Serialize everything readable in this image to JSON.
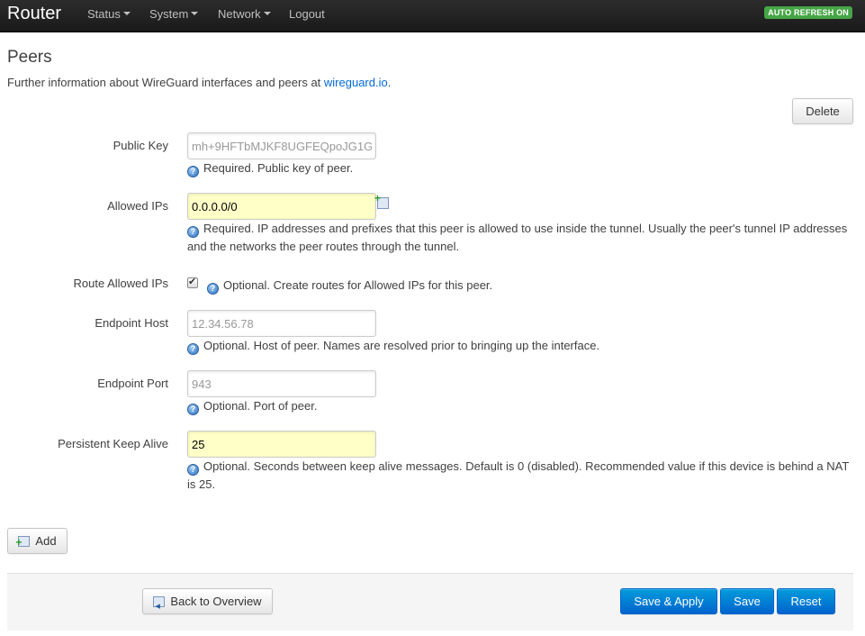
{
  "navbar": {
    "brand": "Router",
    "menu": [
      "Status",
      "System",
      "Network",
      "Logout"
    ],
    "refresh_badge": "AUTO REFRESH ON"
  },
  "header": {
    "title": "Peers",
    "desc_prefix": "Further information about WireGuard interfaces and peers at ",
    "desc_link": "wireguard.io",
    "desc_suffix": "."
  },
  "buttons": {
    "delete": "Delete",
    "add": "Add",
    "back": "Back to Overview",
    "save_apply": "Save & Apply",
    "save": "Save",
    "reset": "Reset"
  },
  "fields": {
    "public_key": {
      "label": "Public Key",
      "value": "",
      "placeholder": "mh+9HFTbMJKF8UGFEQpoJG1G",
      "help": "Required. Public key of peer."
    },
    "allowed_ips": {
      "label": "Allowed IPs",
      "value": "0.0.0.0/0",
      "help": "Required. IP addresses and prefixes that this peer is allowed to use inside the tunnel. Usually the peer's tunnel IP addresses and the networks the peer routes through the tunnel."
    },
    "route_allowed_ips": {
      "label": "Route Allowed IPs",
      "checked": true,
      "help": "Optional. Create routes for Allowed IPs for this peer."
    },
    "endpoint_host": {
      "label": "Endpoint Host",
      "value": "",
      "placeholder": "12.34.56.78",
      "help": "Optional. Host of peer. Names are resolved prior to bringing up the interface."
    },
    "endpoint_port": {
      "label": "Endpoint Port",
      "value": "",
      "placeholder": "943",
      "help": "Optional. Port of peer."
    },
    "keep_alive": {
      "label": "Persistent Keep Alive",
      "value": "25",
      "help": "Optional. Seconds between keep alive messages. Default is 0 (disabled). Recommended value if this device is behind a NAT is 25."
    }
  }
}
